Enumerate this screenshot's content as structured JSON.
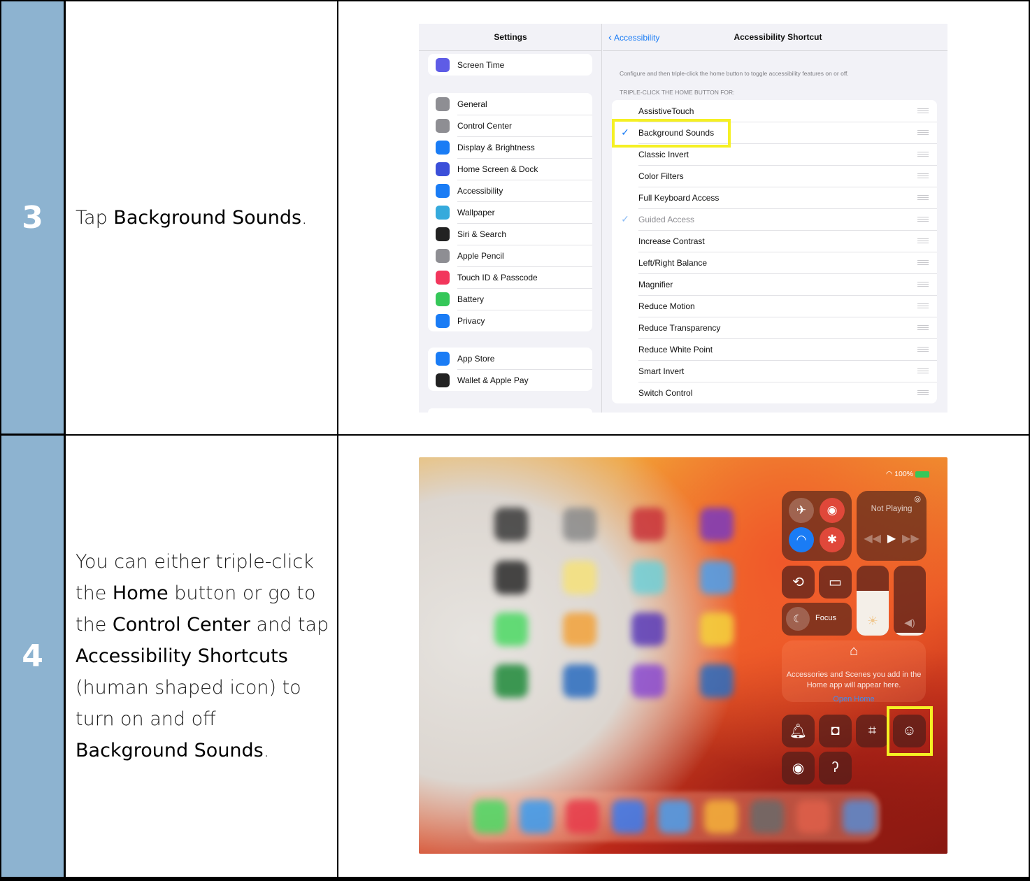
{
  "rows": [
    {
      "step": "3",
      "text_plain_1": "Tap ",
      "text_bold_1": "Background Sounds",
      "text_plain_2": "."
    },
    {
      "step": "4",
      "t1": "You can either triple-click the ",
      "b1": "Home",
      "t2": " button or go to the ",
      "b2": "Control Center",
      "t3": " and tap ",
      "b3": "Accessibility Shortcuts",
      "t4": " (human shaped icon) to turn on and off ",
      "b4": "Background Sounds",
      "t5": "."
    }
  ],
  "settings": {
    "title": "Settings",
    "group0": [
      {
        "label": "Screen Time",
        "icon": "hourglass-icon",
        "color": "#5e5ce6"
      }
    ],
    "group1": [
      {
        "label": "General",
        "icon": "gear-icon",
        "color": "#8e8e93"
      },
      {
        "label": "Control Center",
        "icon": "toggles-icon",
        "color": "#8e8e93"
      },
      {
        "label": "Display & Brightness",
        "icon": "aa-icon",
        "color": "#1a7cf5"
      },
      {
        "label": "Home Screen & Dock",
        "icon": "grid-icon",
        "color": "#3b4fd9"
      },
      {
        "label": "Accessibility",
        "icon": "accessibility-icon",
        "color": "#1a7cf5"
      },
      {
        "label": "Wallpaper",
        "icon": "flower-icon",
        "color": "#35aadc"
      },
      {
        "label": "Siri & Search",
        "icon": "siri-icon",
        "color": "#222"
      },
      {
        "label": "Apple Pencil",
        "icon": "pencil-icon",
        "color": "#8e8e93"
      },
      {
        "label": "Touch ID & Passcode",
        "icon": "fingerprint-icon",
        "color": "#f2365c"
      },
      {
        "label": "Battery",
        "icon": "battery-icon",
        "color": "#35c759"
      },
      {
        "label": "Privacy",
        "icon": "hand-icon",
        "color": "#1a7cf5"
      }
    ],
    "group2": [
      {
        "label": "App Store",
        "icon": "appstore-icon",
        "color": "#1a7cf5"
      },
      {
        "label": "Wallet & Apple Pay",
        "icon": "wallet-icon",
        "color": "#222"
      }
    ]
  },
  "shortcut": {
    "back_label": "Accessibility",
    "title": "Accessibility Shortcut",
    "description": "Configure and then triple-click the home button to toggle accessibility features on or off.",
    "section_header": "TRIPLE-CLICK THE HOME BUTTON FOR:",
    "items": [
      {
        "label": "AssistiveTouch",
        "checked": false
      },
      {
        "label": "Background Sounds",
        "checked": true
      },
      {
        "label": "Classic Invert",
        "checked": false
      },
      {
        "label": "Color Filters",
        "checked": false
      },
      {
        "label": "Full Keyboard Access",
        "checked": false
      },
      {
        "label": "Guided Access",
        "checked": true,
        "dim": true
      },
      {
        "label": "Increase Contrast",
        "checked": false
      },
      {
        "label": "Left/Right Balance",
        "checked": false
      },
      {
        "label": "Magnifier",
        "checked": false
      },
      {
        "label": "Reduce Motion",
        "checked": false
      },
      {
        "label": "Reduce Transparency",
        "checked": false
      },
      {
        "label": "Reduce White Point",
        "checked": false
      },
      {
        "label": "Smart Invert",
        "checked": false
      },
      {
        "label": "Switch Control",
        "checked": false
      }
    ]
  },
  "control_center": {
    "battery_text": "100%",
    "now_playing": "Not Playing",
    "focus_label": "Focus",
    "home_note": "Accessories and Scenes you add in the Home app will appear here.",
    "open_home": "Open Home"
  }
}
